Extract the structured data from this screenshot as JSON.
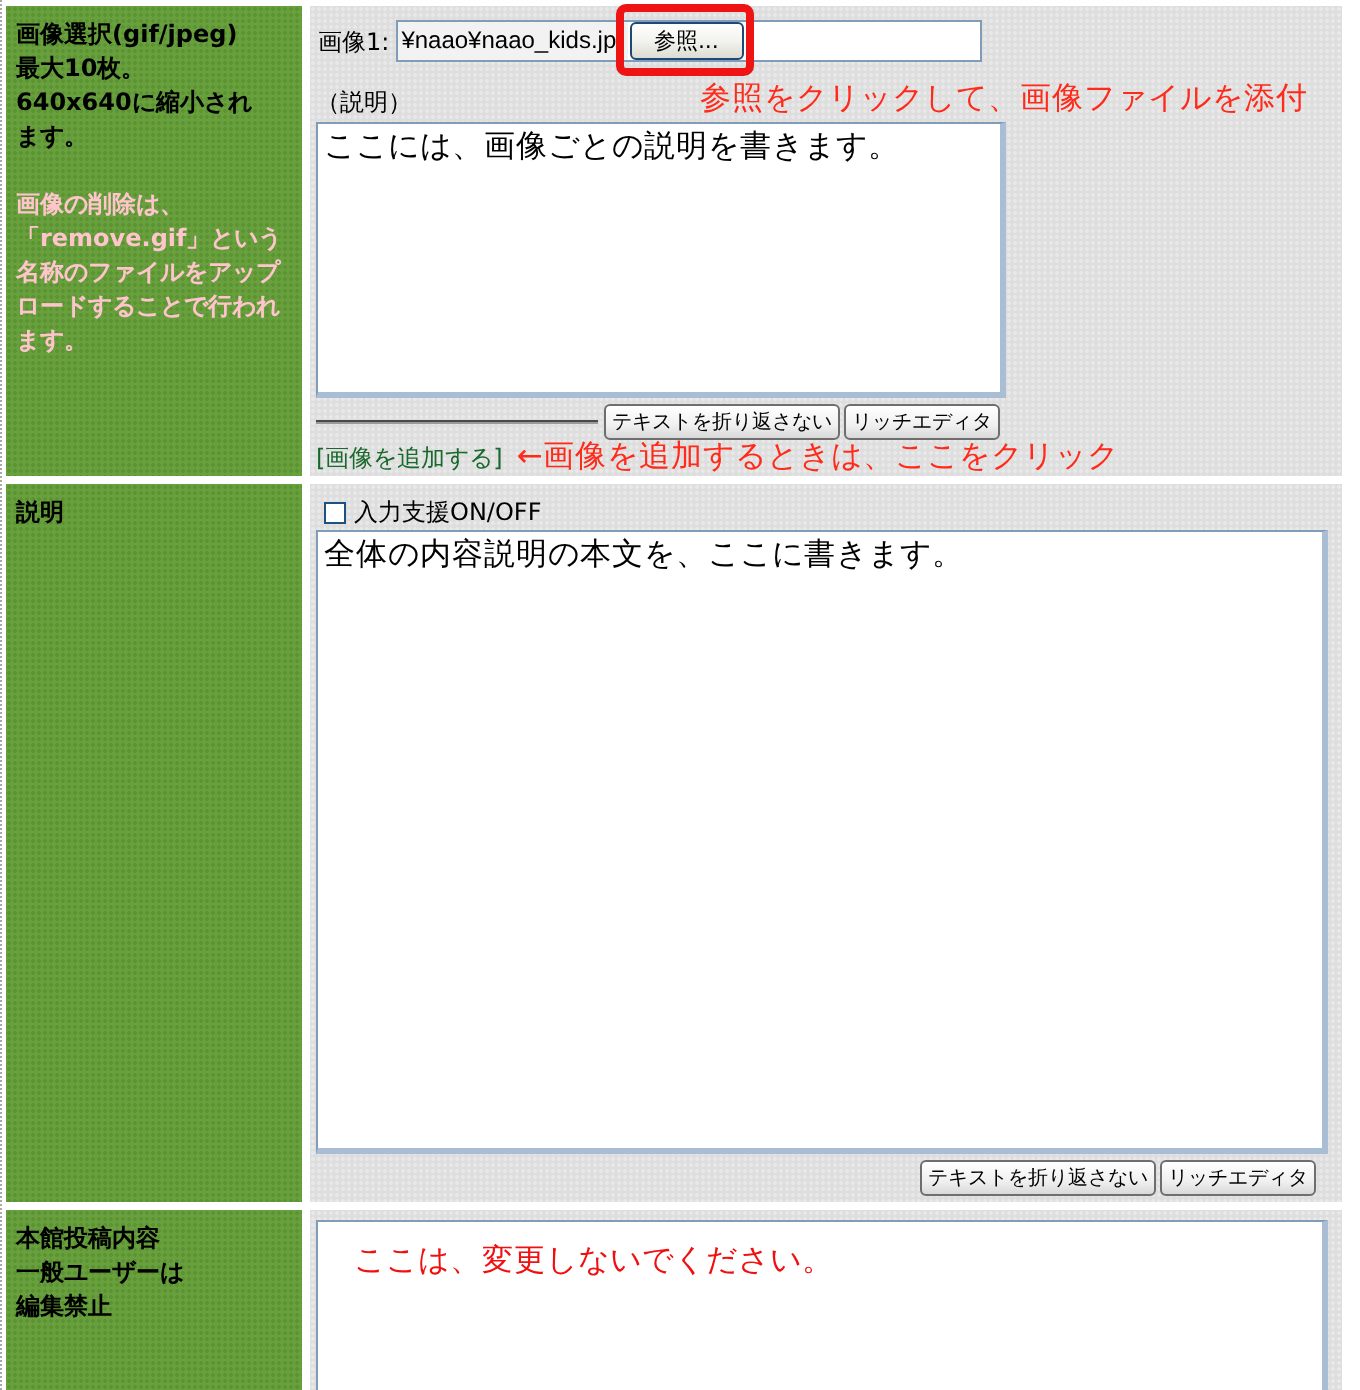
{
  "sections": [
    {
      "kind": "images",
      "heading_lines": [
        "画像選択(gif/jpeg)",
        "最大10枚。",
        "640x640に縮小されます。"
      ],
      "note": "画像の削除は、「remove.gif」という名称のファイルをアップロードすることで行われます。",
      "file": {
        "label": "画像1:",
        "value": "¥naao¥naao_kids.jp",
        "button": "参照...",
        "highlighted": true
      },
      "browse_hint": "参照をクリックして、画像ファイルを添付",
      "caption": {
        "label": "（説明）",
        "value": "ここには、画像ごとの説明を書きます。"
      },
      "editor_buttons": [
        "テキストを折り返さない",
        "リッチエディタ"
      ],
      "add_link": "[画像を追加する]",
      "add_hint": "←画像を追加するときは、ここをクリック"
    },
    {
      "kind": "description",
      "heading_lines": [
        "説明"
      ],
      "assist": {
        "label": "入力支援ON/OFF",
        "checked": false
      },
      "body": "全体の内容説明の本文を、ここに書きます。",
      "editor_buttons": [
        "テキストを折り返さない",
        "リッチエディタ"
      ]
    },
    {
      "kind": "locked",
      "heading_lines": [
        "本館投稿内容",
        "一般ユーザーは",
        "編集禁止"
      ],
      "body": "ここは、変更しないでください。"
    }
  ]
}
